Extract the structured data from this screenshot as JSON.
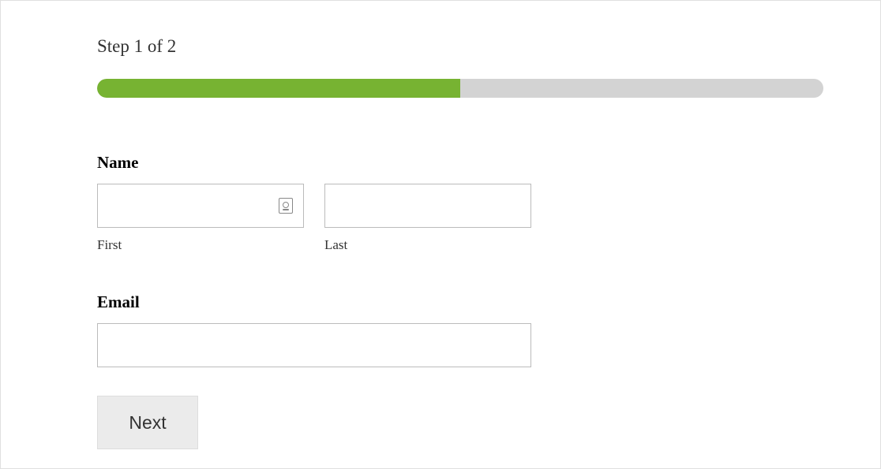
{
  "header": {
    "step_text": "Step 1 of 2"
  },
  "progress": {
    "percent": 50
  },
  "form": {
    "name": {
      "label": "Name",
      "first_sublabel": "First",
      "last_sublabel": "Last",
      "first_value": "",
      "last_value": ""
    },
    "email": {
      "label": "Email",
      "value": ""
    }
  },
  "nav": {
    "next_label": "Next"
  }
}
